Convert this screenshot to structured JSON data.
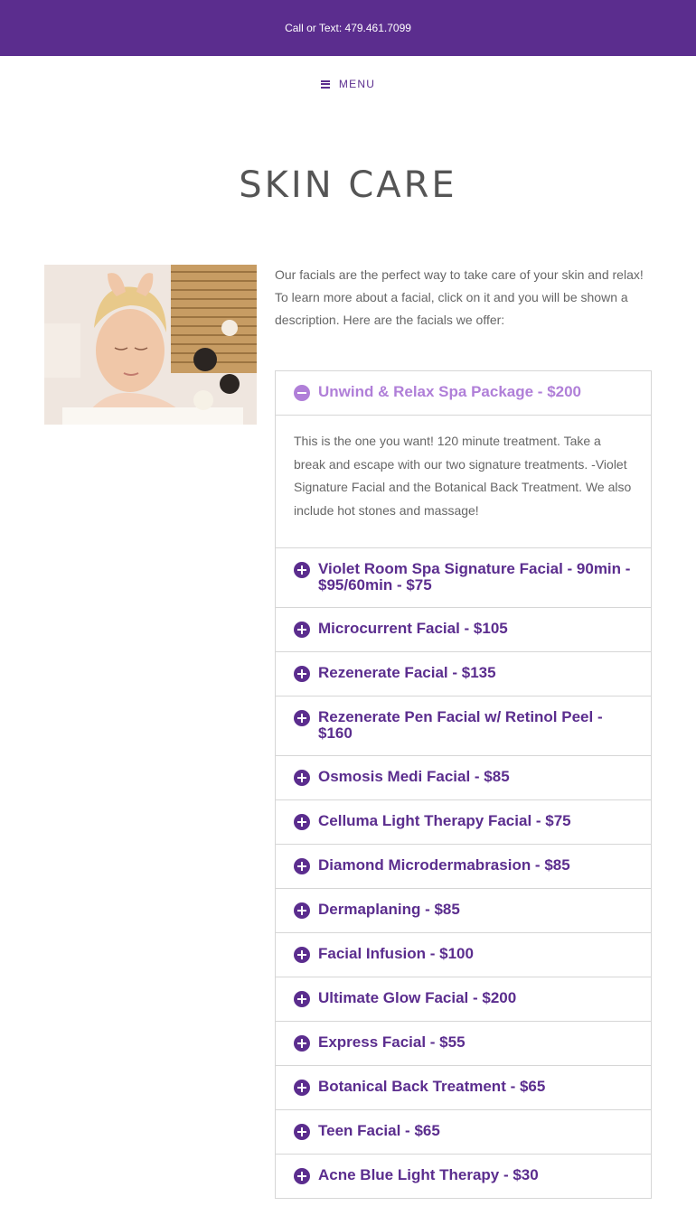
{
  "topbar": {
    "text": "Call or Text: 479.461.7099"
  },
  "nav": {
    "menu_label": "MENU"
  },
  "page": {
    "title": "SKIN CARE"
  },
  "intro": {
    "text": "Our facials are the perfect way to take care of your skin and relax! To learn more about a facial, click on it and you will be shown a description. Here are the facials we offer:"
  },
  "colors": {
    "brand_purple": "#5b2d8e",
    "open_purple": "#b07fd8",
    "border": "#d6d6d6"
  },
  "accordion": {
    "open_item": {
      "title": "Unwind & Relax Spa Package - $200",
      "icon": "minus-circle-icon",
      "body": "This is the one you want! 120 minute treatment. Take a break and escape with our two signature treatments. -Violet Signature Facial and the Botanical Back Treatment. We also include hot stones and massage!"
    },
    "items": [
      "Violet Room Spa Signature Facial - 90min - $95/60min - $75",
      "Microcurrent Facial - $105",
      "Rezenerate Facial - $135",
      "Rezenerate Pen Facial w/ Retinol Peel - $160",
      "Osmosis Medi Facial - $85",
      "Celluma Light Therapy Facial - $75",
      "Diamond Microdermabrasion - $85",
      "Dermaplaning - $85",
      "Facial Infusion - $100",
      "Ultimate Glow Facial - $200",
      "Express Facial - $55",
      "Botanical Back Treatment - $65",
      "Teen Facial - $65",
      "Acne Blue Light Therapy - $30"
    ]
  }
}
